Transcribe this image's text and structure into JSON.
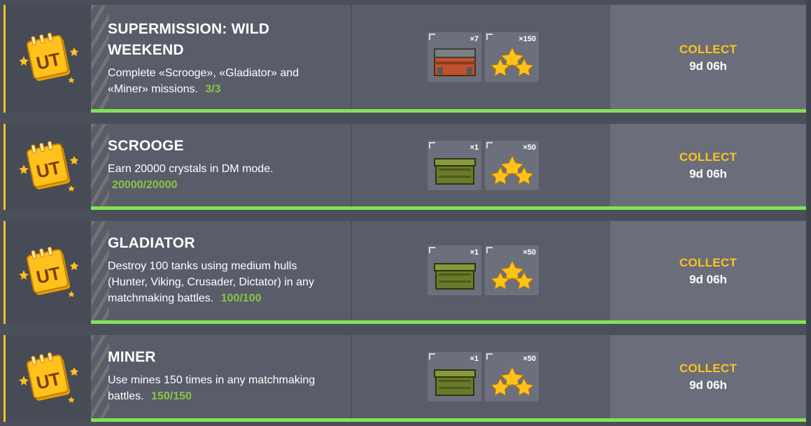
{
  "missions": [
    {
      "title": "SUPERMISSION: WILD WEEKEND",
      "description": "Complete «Scrooge», «Gladiator» and «Miner» missions.",
      "progress": "3/3",
      "rewards": [
        {
          "icon": "red-container-icon",
          "count": "×7"
        },
        {
          "icon": "stars-icon",
          "count": "×150"
        }
      ],
      "collect_label": "COLLECT",
      "timer": "9d 06h",
      "completion": 1.0
    },
    {
      "title": "SCROOGE",
      "description": "Earn 20000 crystals in DM mode.",
      "progress": "20000/20000",
      "rewards": [
        {
          "icon": "green-container-icon",
          "count": "×1"
        },
        {
          "icon": "stars-icon",
          "count": "×50"
        }
      ],
      "collect_label": "COLLECT",
      "timer": "9d 06h",
      "completion": 1.0
    },
    {
      "title": "GLADIATOR",
      "description": "Destroy 100 tanks using medium hulls (Hunter, Viking, Crusader, Dictator) in any matchmaking battles.",
      "progress": "100/100",
      "rewards": [
        {
          "icon": "green-container-icon",
          "count": "×1"
        },
        {
          "icon": "stars-icon",
          "count": "×50"
        }
      ],
      "collect_label": "COLLECT",
      "timer": "9d 06h",
      "completion": 1.0
    },
    {
      "title": "MINER",
      "description": "Use mines 150 times in any matchmaking battles.",
      "progress": "150/150",
      "rewards": [
        {
          "icon": "green-container-icon",
          "count": "×1"
        },
        {
          "icon": "stars-icon",
          "count": "×50"
        }
      ],
      "collect_label": "COLLECT",
      "timer": "9d 06h",
      "completion": 1.0
    }
  ],
  "colors": {
    "accent": "#ffc21d",
    "progress_text": "#8ac444",
    "progress_bar": "#82e352"
  }
}
